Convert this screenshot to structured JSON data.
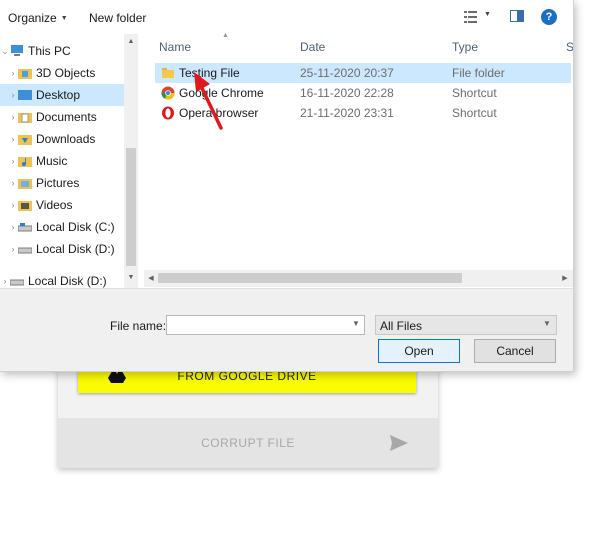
{
  "toolbar": {
    "organize_label": "Organize",
    "new_folder_label": "New folder",
    "help_label": "?"
  },
  "nav": {
    "items": [
      {
        "label": "This PC",
        "icon": "computer-icon"
      },
      {
        "label": "3D Objects",
        "icon": "folder-3d-icon"
      },
      {
        "label": "Desktop",
        "icon": "desktop-folder-icon"
      },
      {
        "label": "Documents",
        "icon": "documents-icon"
      },
      {
        "label": "Downloads",
        "icon": "downloads-icon"
      },
      {
        "label": "Music",
        "icon": "music-icon"
      },
      {
        "label": "Pictures",
        "icon": "pictures-icon"
      },
      {
        "label": "Videos",
        "icon": "videos-icon"
      },
      {
        "label": "Local Disk (C:)",
        "icon": "drive-icon"
      },
      {
        "label": "Local Disk (D:)",
        "icon": "drive-icon"
      },
      {
        "label": "Local Disk (D:)",
        "icon": "drive-icon"
      }
    ]
  },
  "list": {
    "columns": {
      "name": "Name",
      "date": "Date",
      "type": "Type",
      "size": "S"
    },
    "files": [
      {
        "name": "Testing File",
        "date": "25-11-2020 20:37",
        "type": "File folder",
        "icon": "folder-icon"
      },
      {
        "name": "Google Chrome",
        "date": "16-11-2020 22:28",
        "type": "Shortcut",
        "icon": "chrome-icon"
      },
      {
        "name": "Opera browser",
        "date": "21-11-2020 23:31",
        "type": "Shortcut",
        "icon": "opera-icon"
      }
    ]
  },
  "footer": {
    "file_name_label": "File name:",
    "file_name_value": "",
    "filter_value": "All Files",
    "open_label": "Open",
    "cancel_label": "Cancel"
  },
  "webpage": {
    "drive_label": "FROM GOOGLE DRIVE",
    "corrupt_label": "CORRUPT FILE"
  },
  "colors": {
    "selection": "#cce8ff",
    "drive_button": "#fbfb00",
    "annotation_arrow": "#e0191f"
  }
}
